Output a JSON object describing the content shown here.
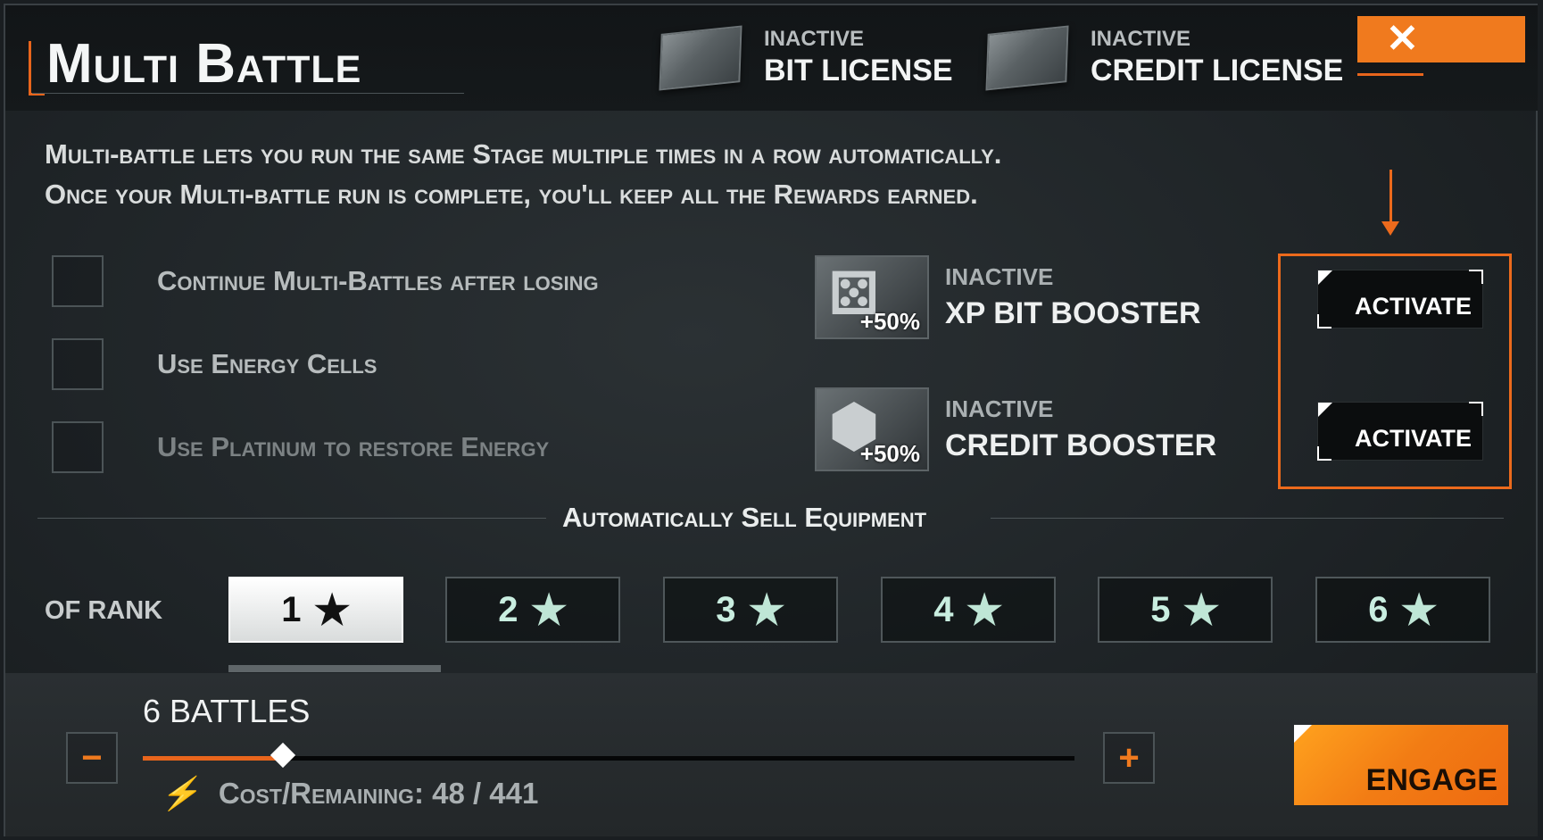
{
  "header": {
    "title": "Multi Battle",
    "licenses": [
      {
        "status": "INACTIVE",
        "name": "BIT LICENSE"
      },
      {
        "status": "INACTIVE",
        "name": "CREDIT LICENSE"
      }
    ],
    "close_label": "✕"
  },
  "description": {
    "line1": "Multi-battle lets you run the same Stage multiple times in a row automatically.",
    "line2": "Once your Multi-battle run is complete, you'll keep all the Rewards earned."
  },
  "options": [
    {
      "label": "Continue Multi-Battles after losing",
      "checked": false
    },
    {
      "label": "Use Energy Cells",
      "checked": false
    },
    {
      "label": "Use Platinum to restore Energy",
      "checked": false,
      "disabled": true
    }
  ],
  "boosters": [
    {
      "status": "INACTIVE",
      "name": "XP BIT BOOSTER",
      "bonus": "+50%",
      "action": "ACTIVATE"
    },
    {
      "status": "INACTIVE",
      "name": "CREDIT BOOSTER",
      "bonus": "+50%",
      "action": "ACTIVATE"
    }
  ],
  "sell": {
    "title": "Automatically Sell Equipment",
    "rank_label": "OF RANK",
    "ranks": [
      "1",
      "2",
      "3",
      "4",
      "5",
      "6"
    ],
    "selected_rank": "1",
    "star": "★"
  },
  "footer": {
    "battles_label": "6 BATTLES",
    "minus": "−",
    "plus": "+",
    "slider_fraction": 0.15,
    "cost_label": "Cost/Remaining: 48 / 441",
    "bolt": "⚡",
    "engage_label": "ENGAGE"
  },
  "colors": {
    "accent": "#ec6a1c",
    "engage": "#f27c14",
    "background": "#1e2326"
  }
}
